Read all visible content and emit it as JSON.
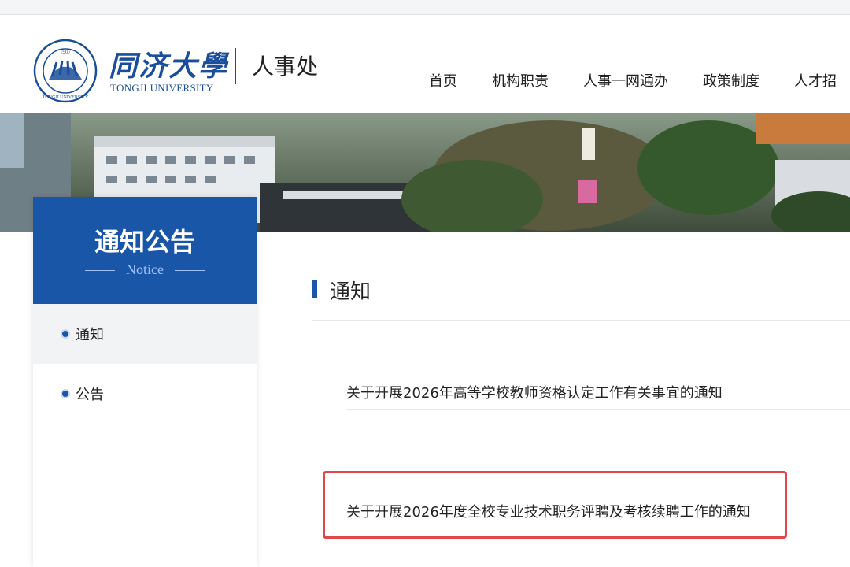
{
  "header": {
    "university_cn": "同济大學",
    "university_en": "TONGJI UNIVERSITY",
    "seal_year": "1907",
    "seal_text": "TONGJI UNIVERSITY",
    "department": "人事处"
  },
  "nav": {
    "items": [
      {
        "label": "首页"
      },
      {
        "label": "机构职责"
      },
      {
        "label": "人事一网通办"
      },
      {
        "label": "政策制度"
      },
      {
        "label": "人才招"
      }
    ]
  },
  "sidebar": {
    "title": "通知公告",
    "subtitle": "Notice",
    "items": [
      {
        "label": "通知",
        "active": true
      },
      {
        "label": "公告",
        "active": false
      }
    ]
  },
  "content": {
    "title": "通知",
    "notices": [
      {
        "title": "关于开展2026年高等学校教师资格认定工作有关事宜的通知"
      },
      {
        "title": "关于开展2026年度全校专业技术职务评聘及考核续聘工作的通知"
      }
    ]
  },
  "colors": {
    "brand_blue": "#1a56a8",
    "highlight_red": "#e0474c"
  }
}
